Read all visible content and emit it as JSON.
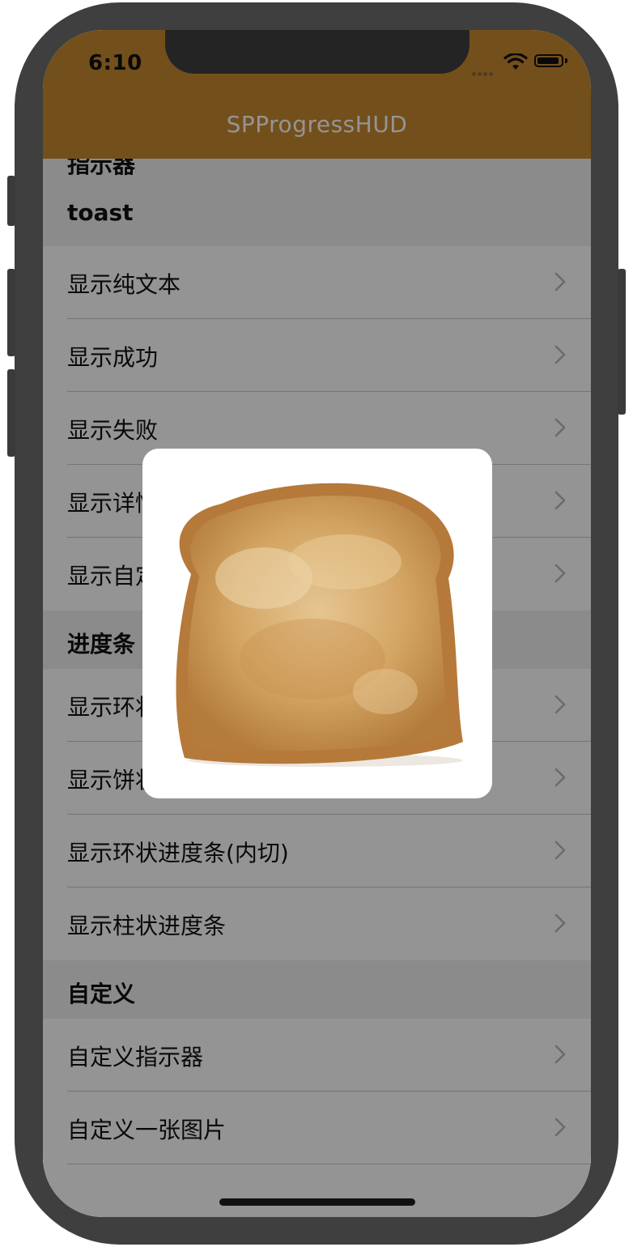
{
  "status_bar": {
    "time": "6:10"
  },
  "nav": {
    "title": "SPProgressHUD"
  },
  "sections": [
    {
      "title": "指示器"
    },
    {
      "title": "toast",
      "rows": [
        {
          "label": "显示纯文本"
        },
        {
          "label": "显示成功"
        },
        {
          "label": "显示失败"
        },
        {
          "label": "显示详情"
        },
        {
          "label": "显示自定义"
        }
      ]
    },
    {
      "title": "进度条",
      "rows": [
        {
          "label": "显示环状进度条"
        },
        {
          "label": "显示饼状进度条"
        },
        {
          "label": "显示环状进度条(内切)"
        },
        {
          "label": "显示柱状进度条"
        }
      ]
    },
    {
      "title": "自定义",
      "rows": [
        {
          "label": "自定义指示器"
        },
        {
          "label": "自定义一张图片"
        }
      ]
    }
  ],
  "hud": {
    "image": "toast-bread-image"
  },
  "colors": {
    "nav_bar": "#c7882f",
    "frame": "#3f3f3f",
    "overlay": "rgba(0,0,0,0.42)"
  }
}
